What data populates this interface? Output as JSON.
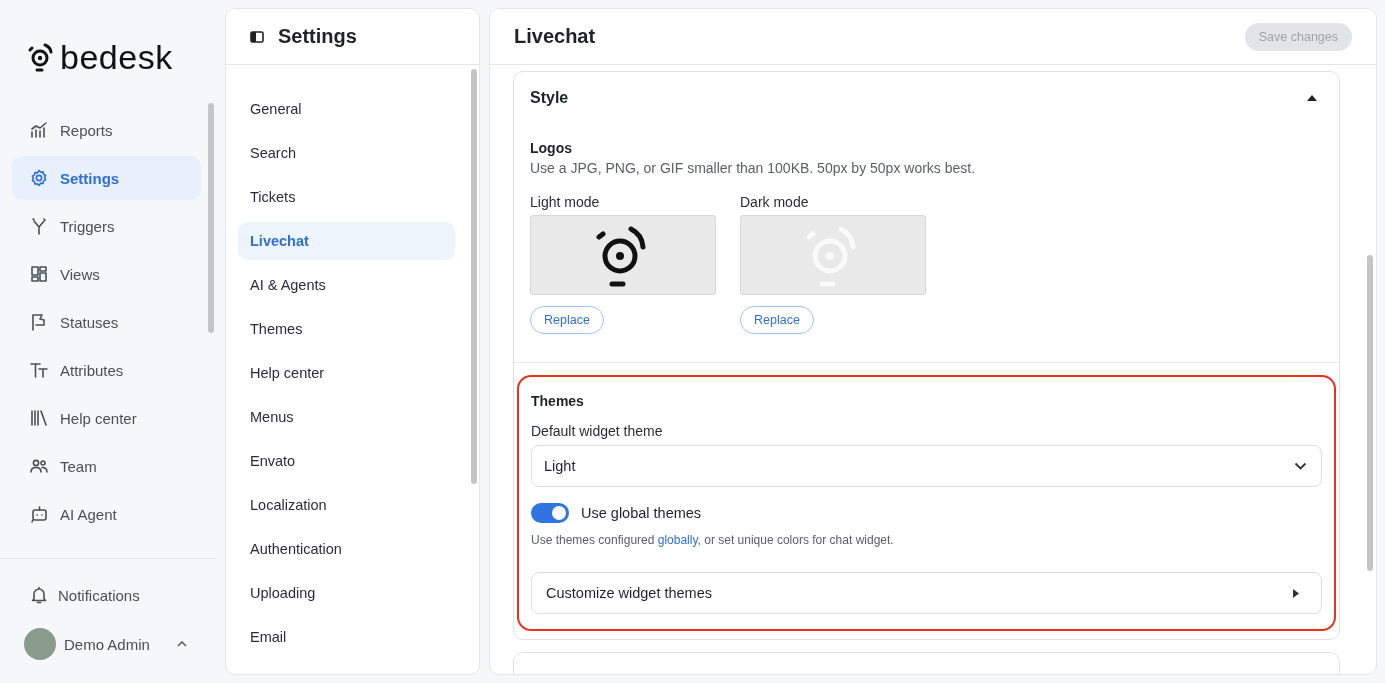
{
  "sidebar": {
    "brand": "bedesk",
    "items": [
      {
        "label": "Reports",
        "selected": false
      },
      {
        "label": "Settings",
        "selected": true
      },
      {
        "label": "Triggers",
        "selected": false
      },
      {
        "label": "Views",
        "selected": false
      },
      {
        "label": "Statuses",
        "selected": false
      },
      {
        "label": "Attributes",
        "selected": false
      },
      {
        "label": "Help center",
        "selected": false
      },
      {
        "label": "Team",
        "selected": false
      },
      {
        "label": "AI Agent",
        "selected": false
      }
    ],
    "notifications": "Notifications",
    "user": {
      "name": "Demo Admin"
    }
  },
  "settings_panel": {
    "title": "Settings",
    "items": [
      {
        "label": "General",
        "selected": false
      },
      {
        "label": "Search",
        "selected": false
      },
      {
        "label": "Tickets",
        "selected": false
      },
      {
        "label": "Livechat",
        "selected": true
      },
      {
        "label": "AI & Agents",
        "selected": false
      },
      {
        "label": "Themes",
        "selected": false
      },
      {
        "label": "Help center",
        "selected": false
      },
      {
        "label": "Menus",
        "selected": false
      },
      {
        "label": "Envato",
        "selected": false
      },
      {
        "label": "Localization",
        "selected": false
      },
      {
        "label": "Authentication",
        "selected": false
      },
      {
        "label": "Uploading",
        "selected": false
      },
      {
        "label": "Email",
        "selected": false
      }
    ]
  },
  "main": {
    "title": "Livechat",
    "save_button": {
      "label": "Save changes",
      "disabled": true
    },
    "style_card": {
      "title": "Style",
      "expanded": true,
      "logos": {
        "title": "Logos",
        "description": "Use a JPG, PNG, or GIF smaller than 100KB. 50px by 50px works best.",
        "slots": [
          {
            "label": "Light mode",
            "kind": "light",
            "button": "Replace"
          },
          {
            "label": "Dark mode",
            "kind": "dark",
            "button": "Replace"
          }
        ]
      },
      "themes": {
        "title": "Themes",
        "highlighted": true,
        "field_label": "Default widget theme",
        "select_value": "Light",
        "toggle": {
          "label": "Use global themes",
          "on": true
        },
        "description": {
          "before": "Use themes configured ",
          "link": "globally",
          "after": ", or set unique colors for chat widget."
        },
        "customize": {
          "label": "Customize widget themes"
        }
      }
    }
  }
}
